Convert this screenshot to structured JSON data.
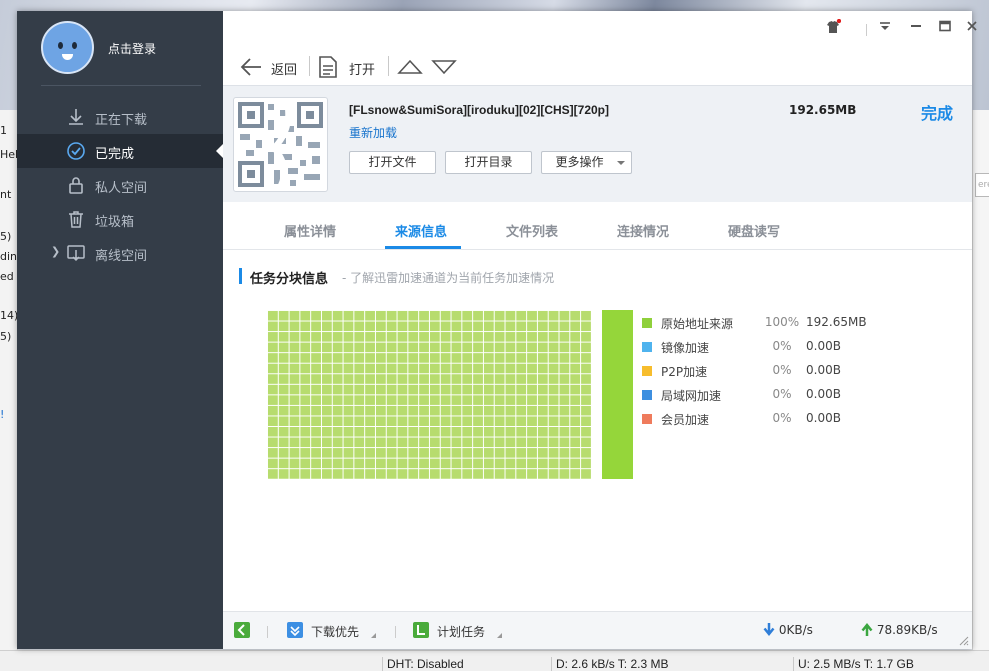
{
  "background": {
    "left_fragments": [
      "1",
      "Hel",
      "nt",
      "5)",
      "din",
      "ed (",
      "14)",
      "5)",
      "!"
    ],
    "right_field_placeholder": "ere",
    "status_bar": [
      "DHT: Disabled",
      "D: 2.6 kB/s T: 2.3 MB",
      "U: 2.5 MB/s T: 1.7 GB"
    ]
  },
  "sidebar": {
    "login_label": "点击登录",
    "items": [
      {
        "label": "正在下载",
        "icon": "download-icon"
      },
      {
        "label": "已完成",
        "icon": "check-circle-icon"
      },
      {
        "label": "私人空间",
        "icon": "lock-icon"
      },
      {
        "label": "垃圾箱",
        "icon": "trash-icon"
      },
      {
        "label": "离线空间",
        "icon": "cloud-download-icon"
      }
    ]
  },
  "toolbar": {
    "back_label": "返回",
    "open_label": "打开"
  },
  "task": {
    "name": "[FLsnow&SumiSora][iroduku][02][CHS][720p]",
    "reload_label": "重新加载",
    "size": "192.65MB",
    "status": "完成",
    "buttons": {
      "open_file": "打开文件",
      "open_dir": "打开目录",
      "more": "更多操作"
    }
  },
  "tabs": [
    "属性详情",
    "来源信息",
    "文件列表",
    "连接情况",
    "硬盘读写"
  ],
  "active_tab": 1,
  "section": {
    "title": "任务分块信息",
    "desc": "- 了解迅雷加速通道为当前任务加速情况"
  },
  "sources": [
    {
      "name": "原始地址来源",
      "percent": "100%",
      "size": "192.65MB",
      "color": "#8fd03b"
    },
    {
      "name": "镜像加速",
      "percent": "0%",
      "size": "0.00B",
      "color": "#4fb3ee"
    },
    {
      "name": "P2P加速",
      "percent": "0%",
      "size": "0.00B",
      "color": "#f7bd2d"
    },
    {
      "name": "局域网加速",
      "percent": "0%",
      "size": "0.00B",
      "color": "#3d8fe0"
    },
    {
      "name": "会员加速",
      "percent": "0%",
      "size": "0.00B",
      "color": "#ef7b5c"
    }
  ],
  "bottom": {
    "priority_label": "下载优先",
    "schedule_label": "计划任务",
    "down_speed": "0KB/s",
    "up_speed": "78.89KB/s"
  },
  "colors": {
    "accent": "#1b8ae6",
    "sidebar": "#343d48",
    "sidebar_active": "#252c35",
    "chunk_done": "#b7dc6e"
  }
}
